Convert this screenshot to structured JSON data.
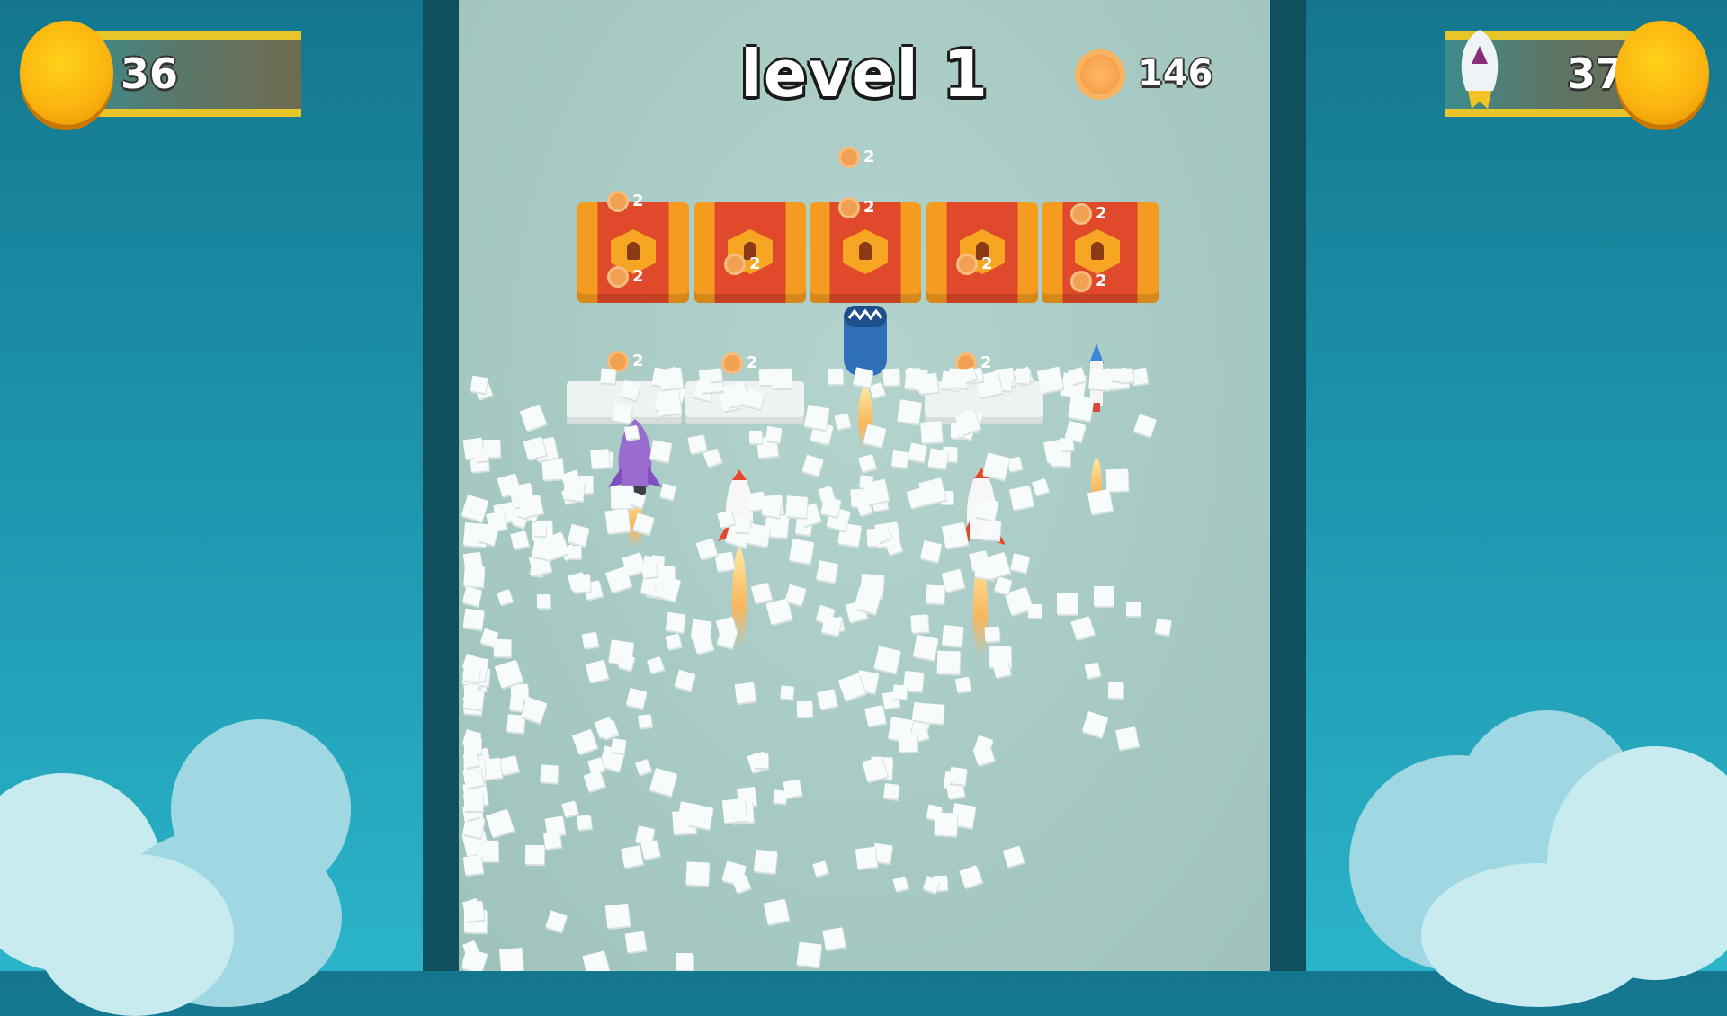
{
  "hud": {
    "left_score": "36",
    "right_score": "37"
  },
  "level": {
    "title": "level 1"
  },
  "coins": {
    "total": "146",
    "block_reward": "2"
  },
  "colors": {
    "sky": "#1c93ab",
    "play_area": "#a6c9c4",
    "coin_gold": "#fbb20f",
    "hud_border": "#e8c529",
    "lock_block_red": "#e04a2a",
    "lock_block_orange": "#f59b1f"
  }
}
